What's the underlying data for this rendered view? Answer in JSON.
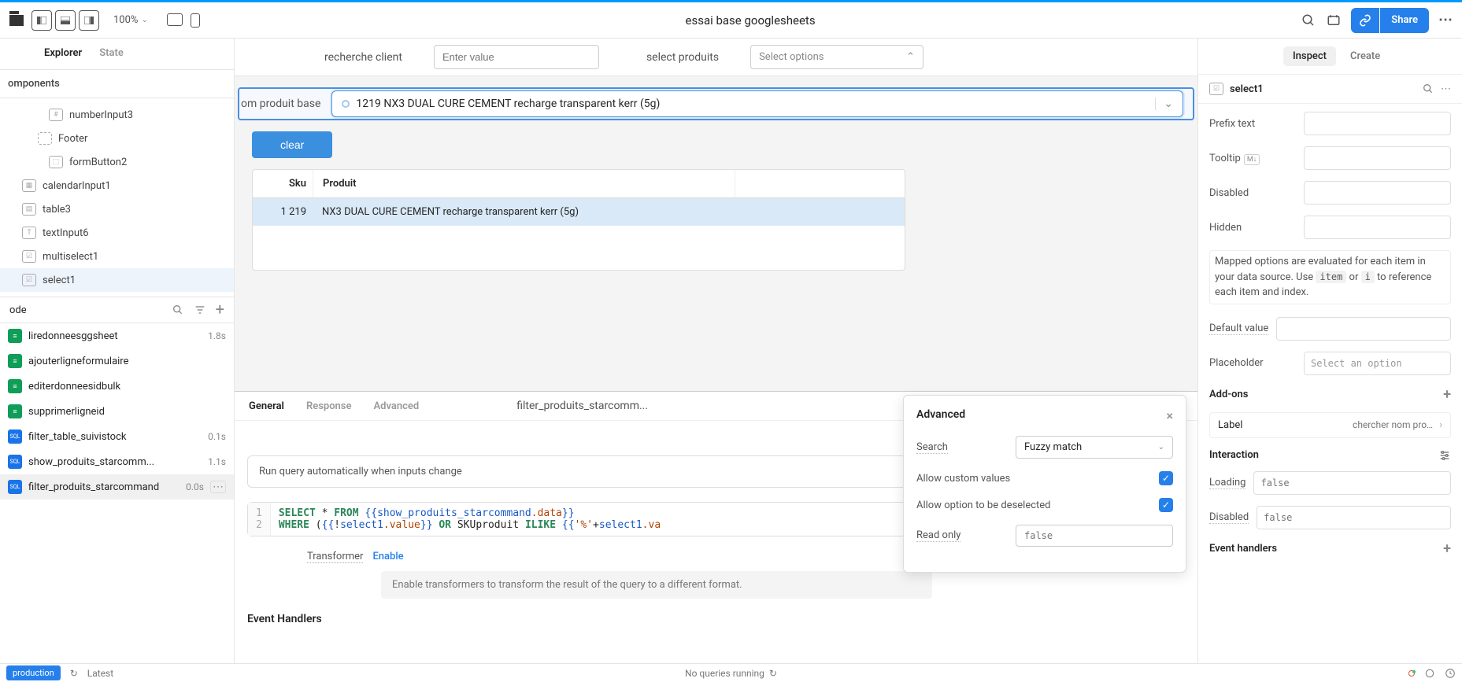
{
  "topbar": {
    "zoom": "100%",
    "title": "essai base googlesheets",
    "share": "Share"
  },
  "leftPanel": {
    "tabs": {
      "explorer": "Explorer",
      "state": "State"
    },
    "componentsHeader": "omponents",
    "tree": [
      {
        "icon": "#",
        "label": "numberInput3"
      },
      {
        "icon": "dashed",
        "label": "Footer"
      },
      {
        "icon": "btn",
        "label": "formButton2"
      },
      {
        "icon": "cal",
        "label": "calendarInput1",
        "sub": 0
      },
      {
        "icon": "tbl",
        "label": "table3",
        "sub": 0
      },
      {
        "icon": "T",
        "label": "textInput6",
        "sub": 0
      },
      {
        "icon": "chk",
        "label": "multiselect1",
        "sub": 0
      },
      {
        "icon": "chk",
        "label": "select1",
        "sub": 0,
        "selected": true
      }
    ],
    "codeHeader": "ode",
    "codeItems": [
      {
        "type": "gs",
        "label": "liredonneesggsheet",
        "time": "1.8s"
      },
      {
        "type": "gs",
        "label": "ajouterligneformulaire"
      },
      {
        "type": "gs",
        "label": "editerdonneesidbulk"
      },
      {
        "type": "gs",
        "label": "supprimerligneid"
      },
      {
        "type": "sql",
        "label": "filter_table_suivistock",
        "time": "0.1s"
      },
      {
        "type": "sql",
        "label": "show_produits_starcomm...",
        "time": "1.1s"
      },
      {
        "type": "sql",
        "label": "filter_produits_starcommand",
        "time": "0.0s",
        "selected": true,
        "more": true
      }
    ]
  },
  "canvas": {
    "rechercheLabel": "recherche client",
    "recherchePlaceholder": "Enter value",
    "selectProduitsLabel": "select produits",
    "selectProduitsPlaceholder": "Select options",
    "productRowLabel": "om produit base",
    "productValue": "1219  NX3 DUAL CURE CEMENT recharge transparent  kerr (5g)",
    "clearBtn": "clear",
    "table": {
      "headers": {
        "sku": "Sku",
        "produit": "Produit"
      },
      "row": {
        "sku": "1 219",
        "produit": "NX3 DUAL CURE CEMENT recharge transparent kerr (5g)"
      }
    }
  },
  "queryPanel": {
    "tabs": {
      "general": "General",
      "response": "Response",
      "advanced": "Advanced"
    },
    "queryName": "filter_produits_starcomm...",
    "autoRun": "Run query automatically when inputs change",
    "line1_select": "SELECT",
    "line1_star": " * ",
    "line1_from": "FROM",
    "line1_tmpl_open": " {{",
    "line1_tmpl_path": "show_produits_starcommand",
    "line1_tmpl_prop": ".data",
    "line1_tmpl_close": "}}",
    "line2_where": "WHERE",
    "line2_open": " (",
    "line2_tmpl1_open": "{{",
    "line2_tmpl1_neg": "!",
    "line2_tmpl1_path": "select1",
    "line2_tmpl1_prop": ".value",
    "line2_tmpl1_close": "}}",
    "line2_or": " OR ",
    "line2_col": "SKUproduit ",
    "line2_ilike": "ILIKE",
    "line2_tmpl2_open": " {{",
    "line2_tmpl2_str": "'%'",
    "line2_tmpl2_plus": "+",
    "line2_tmpl2_path": "select1",
    "line2_tmpl2_prop": ".va",
    "transformerLabel": "Transformer",
    "transformerEnable": "Enable",
    "transformerHint": "Enable transformers to transform the result of the query to a different format.",
    "eventHandlers": "Event Handlers"
  },
  "advancedPopup": {
    "title": "Advanced",
    "searchLabel": "Search",
    "searchValue": "Fuzzy match",
    "allowCustom": "Allow custom values",
    "allowDeselect": "Allow option to be deselected",
    "readOnly": "Read only",
    "readOnlyPlaceholder": "false"
  },
  "rightPanel": {
    "tabs": {
      "inspect": "Inspect",
      "create": "Create"
    },
    "componentName": "select1",
    "prefixText": "Prefix text",
    "tooltip": "Tooltip",
    "disabled": "Disabled",
    "hidden": "Hidden",
    "mappedHint_p1": "Mapped options are evaluated for each item in your data source. Use ",
    "mappedHint_code1": "item",
    "mappedHint_or": " or ",
    "mappedHint_code2": "i",
    "mappedHint_p2": " to reference each item and index.",
    "defaultValueLabel": "Default value",
    "placeholderLabel": "Placeholder",
    "placeholderValue": "Select an option",
    "addonsLabel": "Add-ons",
    "addonLabel": "Label",
    "addonValue": "chercher nom pro…",
    "interactionLabel": "Interaction",
    "loadingLabel": "Loading",
    "loadingPlaceholder": "false",
    "disabled2Label": "Disabled",
    "disabled2Placeholder": "false",
    "eventHandlersLabel": "Event handlers"
  },
  "footer": {
    "env": "production",
    "latest": "Latest",
    "status": "No queries running"
  }
}
